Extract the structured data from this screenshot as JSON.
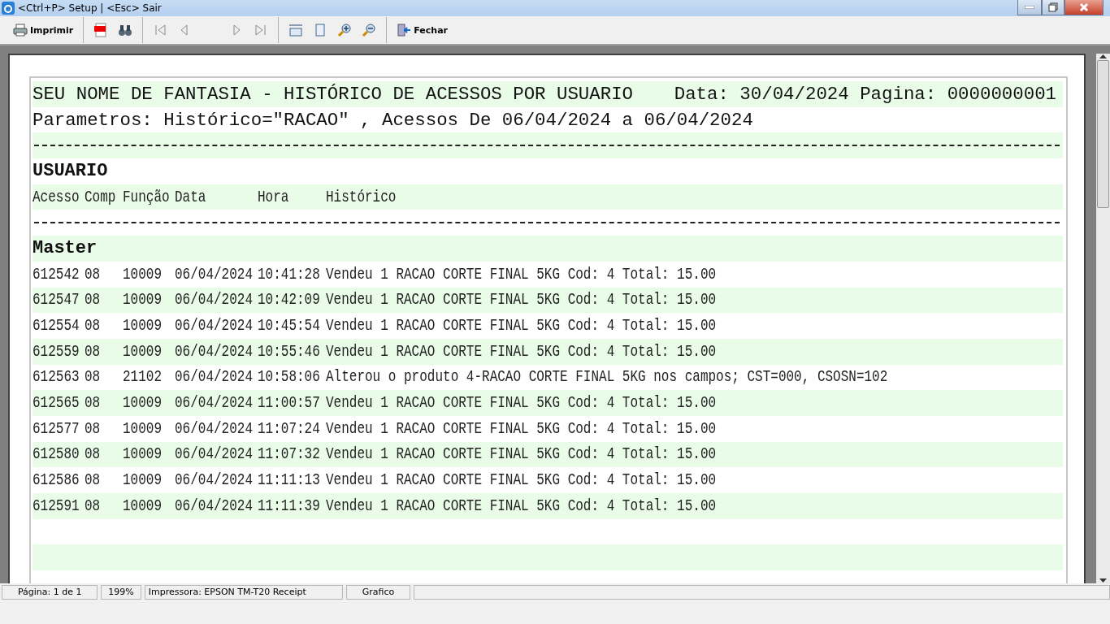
{
  "window": {
    "title": "<Ctrl+P> Setup | <Esc> Sair"
  },
  "toolbar": [
    {
      "kind": "print",
      "label": "Imprimir"
    },
    {
      "kind": "sep"
    },
    {
      "kind": "pdf"
    },
    {
      "kind": "find"
    },
    {
      "kind": "sep"
    },
    {
      "kind": "first"
    },
    {
      "kind": "prev"
    },
    {
      "kind": "gap"
    },
    {
      "kind": "next"
    },
    {
      "kind": "last"
    },
    {
      "kind": "sep"
    },
    {
      "kind": "width"
    },
    {
      "kind": "page"
    },
    {
      "kind": "zoomin"
    },
    {
      "kind": "zoomout"
    },
    {
      "kind": "sep"
    },
    {
      "kind": "close",
      "label": "Fechar"
    }
  ],
  "report": {
    "title": "SEU NOME DE FANTASIA - HISTÓRICO DE ACESSOS POR USUARIO",
    "date_page": "Data: 30/04/2024 Pagina: 0000000001",
    "parameters": "Parametros: Histórico=\"RACAO\" , Acessos De 06/04/2024 a 06/04/2024",
    "section": "USUARIO",
    "columns": [
      "Acesso",
      "Comp",
      "Função",
      "Data",
      "Hora",
      "Histórico"
    ],
    "group": "Master",
    "rows": [
      [
        "612542",
        "08",
        "10009",
        "06/04/2024",
        "10:41:28",
        "Vendeu 1 RACAO CORTE FINAL 5KG Cod: 4 Total: 15.00"
      ],
      [
        "612547",
        "08",
        "10009",
        "06/04/2024",
        "10:42:09",
        "Vendeu 1 RACAO CORTE FINAL 5KG Cod: 4 Total: 15.00"
      ],
      [
        "612554",
        "08",
        "10009",
        "06/04/2024",
        "10:45:54",
        "Vendeu 1 RACAO CORTE FINAL 5KG Cod: 4 Total: 15.00"
      ],
      [
        "612559",
        "08",
        "10009",
        "06/04/2024",
        "10:55:46",
        "Vendeu 1 RACAO CORTE FINAL 5KG Cod: 4 Total: 15.00"
      ],
      [
        "612563",
        "08",
        "21102",
        "06/04/2024",
        "10:58:06",
        "Alterou o produto 4-RACAO CORTE FINAL 5KG nos campos; CST=000, CSOSN=102"
      ],
      [
        "612565",
        "08",
        "10009",
        "06/04/2024",
        "11:00:57",
        "Vendeu 1 RACAO CORTE FINAL 5KG Cod: 4 Total: 15.00"
      ],
      [
        "612577",
        "08",
        "10009",
        "06/04/2024",
        "11:07:24",
        "Vendeu 1 RACAO CORTE FINAL 5KG Cod: 4 Total: 15.00"
      ],
      [
        "612580",
        "08",
        "10009",
        "06/04/2024",
        "11:07:32",
        "Vendeu 1 RACAO CORTE FINAL 5KG Cod: 4 Total: 15.00"
      ],
      [
        "612586",
        "08",
        "10009",
        "06/04/2024",
        "11:11:13",
        "Vendeu 1 RACAO CORTE FINAL 5KG Cod: 4 Total: 15.00"
      ],
      [
        "612591",
        "08",
        "10009",
        "06/04/2024",
        "11:11:39",
        "Vendeu 1 RACAO CORTE FINAL 5KG Cod: 4 Total: 15.00"
      ]
    ]
  },
  "status_bar": [
    "Página: 1 de 1",
    "199%",
    "Impressora: EPSON TM-T20 Receipt",
    "Grafico"
  ]
}
